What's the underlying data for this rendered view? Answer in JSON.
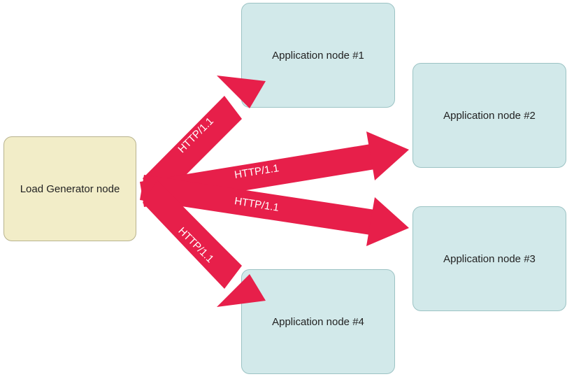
{
  "nodes": {
    "loadGenerator": {
      "label": "Load Generator node"
    },
    "app1": {
      "label": "Application node #1"
    },
    "app2": {
      "label": "Application node #2"
    },
    "app3": {
      "label": "Application node #3"
    },
    "app4": {
      "label": "Application node #4"
    }
  },
  "arrows": {
    "protocol": "HTTP/1.1",
    "color": "#e71f4a"
  }
}
